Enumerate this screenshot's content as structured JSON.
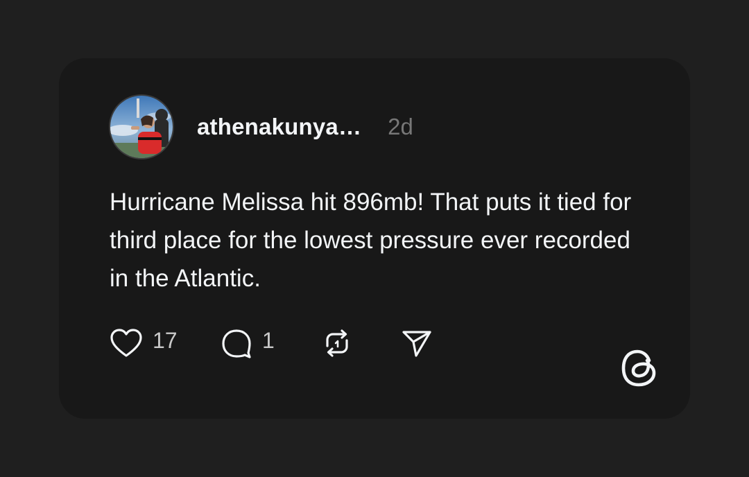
{
  "post": {
    "username": "athenakunya…",
    "timestamp": "2d",
    "text": "Hurricane Melissa hit 896mb! That puts it tied for third place for the lowest pressure ever recorded in the Atlantic.",
    "likes": "17",
    "replies": "1"
  },
  "icons": {
    "like": "heart-icon",
    "reply": "speech-bubble-icon",
    "repost": "repost-icon",
    "share": "paper-plane-icon",
    "brand": "threads-logo"
  },
  "colors": {
    "background": "#1f1f1f",
    "card": "#181818",
    "text": "#f3f5f7",
    "muted": "#777777"
  }
}
